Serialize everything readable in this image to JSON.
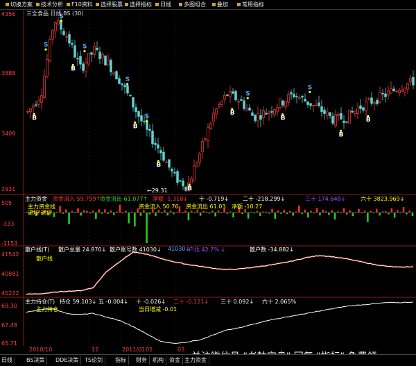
{
  "toolbar": {
    "items": [
      "切换方案",
      "技术分析",
      "F10资料",
      "选择股票",
      "选择指标",
      "日线",
      "多图组合",
      "叠加",
      "常用指标"
    ]
  },
  "price_pane": {
    "title": "三全食品 日线 BS (30)",
    "y_labels": [
      "4356",
      "3888",
      "3409",
      "2931"
    ],
    "low_annotation": "←29.31"
  },
  "fund_pane": {
    "header": "主力资金",
    "header_values": [
      "资金流入 59.759↑",
      "资金流出 61.077↑",
      "净额 -1.318↓",
      "十 -0.719↓",
      "二十 -218.299↓",
      "三十 174.648↓",
      "六十 3823.969↓"
    ],
    "legend": [
      "主力资金线",
      "进场 退场"
    ],
    "mid_values": [
      "资金流入 50.76",
      "资金流出 61.03",
      "净额 -10.27"
    ],
    "y_labels": [
      "505",
      "-333",
      "-1153"
    ]
  },
  "retail_pane": {
    "header": "散户线(T)",
    "header_values": [
      "散户总量 24.870↓",
      "散户账号数 41030↓",
      "41030↓",
      "户比 42.7% ↓",
      "散户数 -34.882↓"
    ],
    "legend": "散户线",
    "y_labels": [
      "41542",
      "40881",
      "40222"
    ]
  },
  "holding_pane": {
    "header": "主力持仓(T)",
    "header_values": [
      "持仓 59.103↓",
      "五 -0.004↓",
      "十 -0.026↓",
      "二十 -0.121↓",
      "三十 0.092↓",
      "六十 2.065%"
    ],
    "legend": "主力持仓",
    "mid_value": "当日增减 -0.01",
    "y_labels": [
      "69.30",
      "67.48",
      "65.71"
    ]
  },
  "dates": [
    "2010/10",
    "12",
    "2011/01",
    "02",
    "03"
  ],
  "tabs": [
    "日线",
    "BS决策",
    "DDE决策",
    "TS论剑",
    "指标",
    "财务",
    "机构",
    "资金",
    "主力资金"
  ],
  "watermark": "关注微信号 \"老韩实盘\" 回复 \"指标\" 免费领",
  "colors": {
    "up": "#ff3b3b",
    "down": "#5fd3d3",
    "bg": "#000000",
    "axis": "#8b1a1a",
    "label_yellow": "#ffff00",
    "buy_signal": "#ffffff",
    "sell_signal": "#5aa0ff"
  },
  "chart_data": [
    {
      "type": "candlestick",
      "title": "三全食品 日线 BS (30)",
      "ylim": [
        2931,
        4356
      ],
      "y_ticks": [
        4356,
        3888,
        3409,
        2931
      ],
      "x_ticks": [
        "2010/10",
        "12",
        "2011/01",
        "02",
        "03"
      ],
      "waypoints": [
        3560,
        3700,
        4290,
        4150,
        3900,
        4050,
        3950,
        3800,
        3600,
        3400,
        3250,
        3050,
        2970,
        3250,
        3550,
        3700,
        3650,
        3520,
        3560,
        3630,
        3700,
        3640,
        3580,
        3500,
        3520,
        3600,
        3650,
        3700,
        3760,
        3800
      ],
      "signals": [
        {
          "kind": "B",
          "at": 0.02
        },
        {
          "kind": "S",
          "at": 0.05
        },
        {
          "kind": "S",
          "at": 0.09
        },
        {
          "kind": "B",
          "at": 0.12
        },
        {
          "kind": "S",
          "at": 0.15
        },
        {
          "kind": "S",
          "at": 0.26
        },
        {
          "kind": "B",
          "at": 0.28
        },
        {
          "kind": "S",
          "at": 0.31
        },
        {
          "kind": "B",
          "at": 0.34
        },
        {
          "kind": "B",
          "at": 0.42
        },
        {
          "kind": "B",
          "at": 0.53
        },
        {
          "kind": "S",
          "at": 0.57
        },
        {
          "kind": "B",
          "at": 0.66
        },
        {
          "kind": "S",
          "at": 0.73
        },
        {
          "kind": "B",
          "at": 0.81
        },
        {
          "kind": "B",
          "at": 0.88
        }
      ]
    },
    {
      "type": "bar",
      "title": "主力资金",
      "ylim": [
        -1153,
        505
      ],
      "y_ticks": [
        505,
        -333,
        -1153
      ],
      "seed_pattern": [
        40,
        -60,
        120,
        -200,
        80,
        -30,
        150,
        -80,
        60,
        -120,
        30,
        200,
        -40,
        90,
        -300,
        50,
        -20,
        110,
        -90,
        70
      ]
    },
    {
      "type": "line",
      "title": "散户线",
      "ylim": [
        40222,
        41542
      ],
      "y_ticks": [
        41542,
        40881,
        40222
      ],
      "waypoints": [
        40230,
        40240,
        40280,
        40320,
        40330,
        40420,
        40900,
        41200,
        41480,
        41420,
        41300,
        41200,
        41120,
        41060,
        41000,
        40960,
        40980,
        41030,
        41080,
        41140,
        41220,
        41320,
        41380,
        41340,
        41280,
        41200,
        41120,
        41060,
        41030,
        41050
      ]
    },
    {
      "type": "line",
      "title": "主力持仓",
      "ylim": [
        65.71,
        69.3
      ],
      "y_ticks": [
        69.3,
        67.48,
        65.71
      ],
      "waypoints": [
        68.4,
        68.6,
        68.7,
        68.3,
        68.2,
        68.3,
        68.0,
        67.7,
        67.2,
        66.6,
        66.0,
        65.8,
        65.9,
        66.1,
        66.5,
        66.9,
        67.1,
        67.4,
        67.7,
        67.9,
        68.1,
        68.3,
        68.5,
        68.7,
        68.9,
        69.0,
        69.1,
        69.2,
        69.2,
        69.25
      ]
    }
  ]
}
